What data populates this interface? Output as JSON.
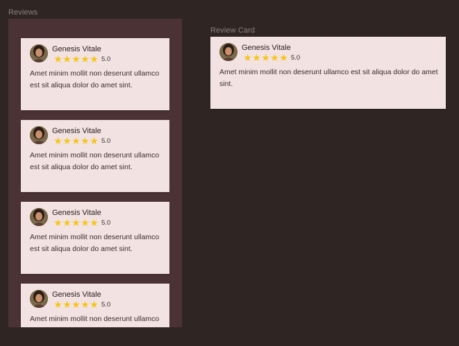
{
  "labels": {
    "reviews_frame": "Reviews",
    "card_frame": "Review Card"
  },
  "reviews": [
    {
      "name": "Genesis Vitale",
      "rating": "5.0",
      "stars": 5,
      "text": "Amet minim mollit non deserunt ullamco est sit aliqua dolor do amet sint."
    },
    {
      "name": "Genesis Vitale",
      "rating": "5.0",
      "stars": 5,
      "text": "Amet minim mollit non deserunt ullamco est sit aliqua dolor do amet sint."
    },
    {
      "name": "Genesis Vitale",
      "rating": "5.0",
      "stars": 5,
      "text": "Amet minim mollit non deserunt ullamco est sit aliqua dolor do amet sint."
    },
    {
      "name": "Genesis Vitale",
      "rating": "5.0",
      "stars": 5,
      "text": "Amet minim mollit non deserunt ullamco est sit aliqua dolor do amet sint."
    }
  ],
  "review_card": {
    "name": "Genesis Vitale",
    "rating": "5.0",
    "stars": 5,
    "text": "Amet minim mollit non deserunt ullamco est sit aliqua dolor do amet sint."
  },
  "icons": {
    "star": "star-icon",
    "avatar": "avatar-image"
  },
  "colors": {
    "background": "#2f2624",
    "frame": "#4b3235",
    "card": "#f2e2e2",
    "star": "#f5c518"
  }
}
